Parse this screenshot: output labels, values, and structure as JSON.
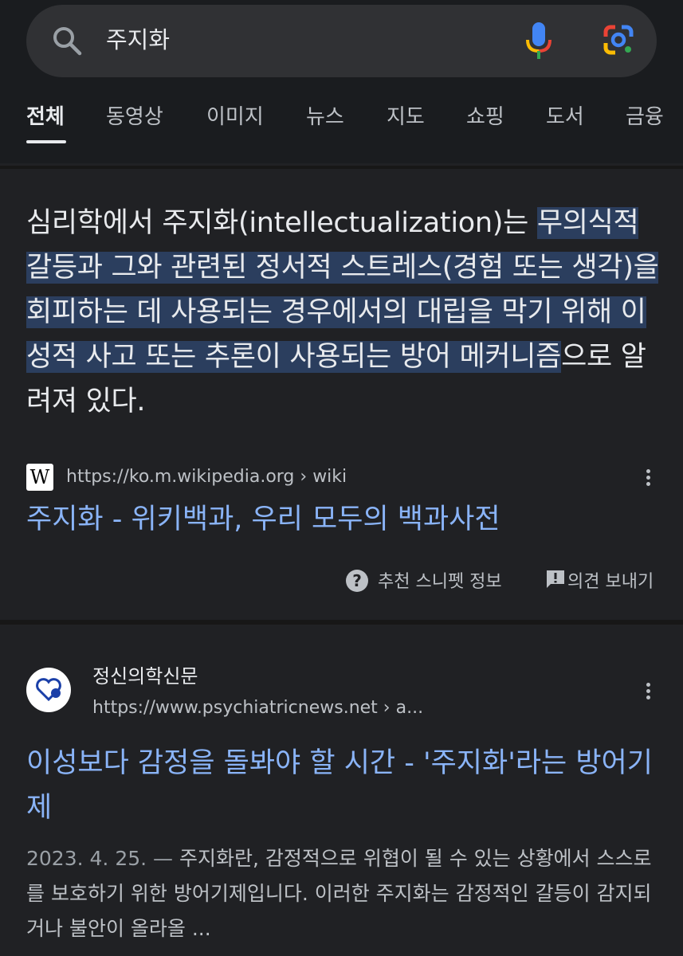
{
  "search": {
    "query": "주지화"
  },
  "tabs": [
    {
      "label": "전체",
      "active": true
    },
    {
      "label": "동영상"
    },
    {
      "label": "이미지"
    },
    {
      "label": "뉴스"
    },
    {
      "label": "지도"
    },
    {
      "label": "쇼핑"
    },
    {
      "label": "도서"
    },
    {
      "label": "금융"
    }
  ],
  "featured_snippet": {
    "text_plain": "심리학에서 주지화(intellectualization)는 ",
    "text_highlight": "무의식적 갈등과 그와 관련된 정서적 스트레스(경험 또는 생각)을 회피하는 데 사용되는 경우에서의 대립을 막기 위해 이성적 사고 또는 추론이 사용되는 방어 메커니즘",
    "text_tail": "으로 알려져 있다.",
    "source_url": "https://ko.m.wikipedia.org",
    "source_path": " › wiki",
    "source_logo": "W",
    "title": "주지화 - 위키백과, 우리 모두의 백과사전",
    "about_label": "추천 스니펫 정보",
    "feedback_label": "의견 보내기"
  },
  "result2": {
    "site_name": "정신의학신문",
    "url": "https://www.psychiatricnews.net",
    "url_path": " › a...",
    "title": "이성보다 감정을 돌봐야 할 시간 - '주지화'라는 방어기제",
    "date": "2023. 4. 25.",
    "separator": " — ",
    "snippet": "주지화란, 감정적으로 위협이 될 수 있는 상황에서 스스로를 보호하기 위한 방어기제입니다. 이러한 주지화는 감정적인 갈등이 감지되거나 불안이 올라올 ..."
  },
  "colors": {
    "background": "#202124",
    "header_background": "#1a1c1f",
    "search_bar": "#303134",
    "link": "#8ab4f8",
    "highlight": "#2b3e5e",
    "text": "#e8eaed",
    "secondary_text": "#bdc1c6"
  },
  "icons": {
    "search": "search-icon",
    "mic": "mic-icon",
    "lens": "google-lens-icon",
    "more": "more-vert-icon",
    "help": "help-circle-icon",
    "feedback": "feedback-icon",
    "site": "heart-icon"
  }
}
